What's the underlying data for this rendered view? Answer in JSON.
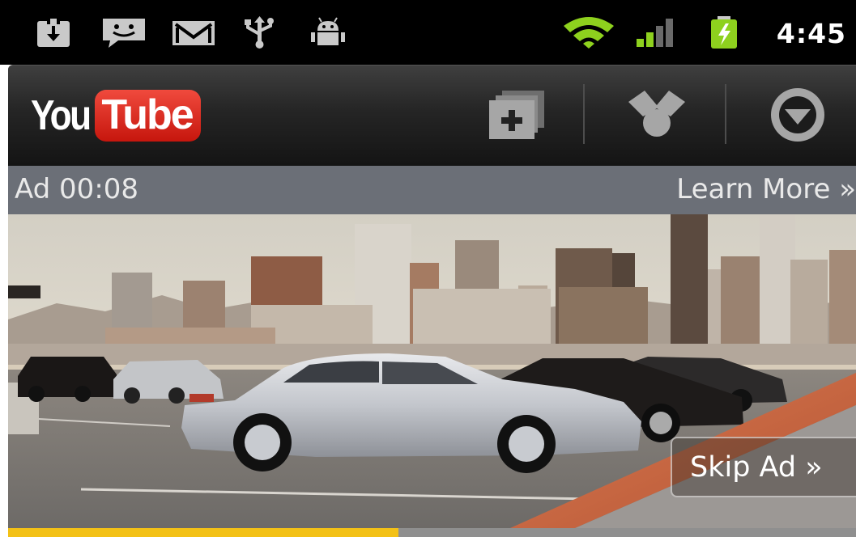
{
  "status_bar": {
    "time": "4:45",
    "icons": [
      "download-icon",
      "messaging-icon",
      "gmail-icon",
      "usb-icon",
      "android-debug-icon",
      "wifi-icon",
      "signal-icon",
      "battery-charging-icon"
    ]
  },
  "action_bar": {
    "logo": {
      "part1": "You",
      "part2": "Tube"
    },
    "actions": [
      "add-to-playlist-icon",
      "share-icon",
      "more-icon"
    ]
  },
  "ad": {
    "timer": "Ad 00:08",
    "learn_more": "Learn More »",
    "skip": "Skip Ad »",
    "progress": 0.46
  },
  "colors": {
    "accent": "#f3c116",
    "wifi": "#8ed11e",
    "youtube_red": "#e1261c"
  }
}
